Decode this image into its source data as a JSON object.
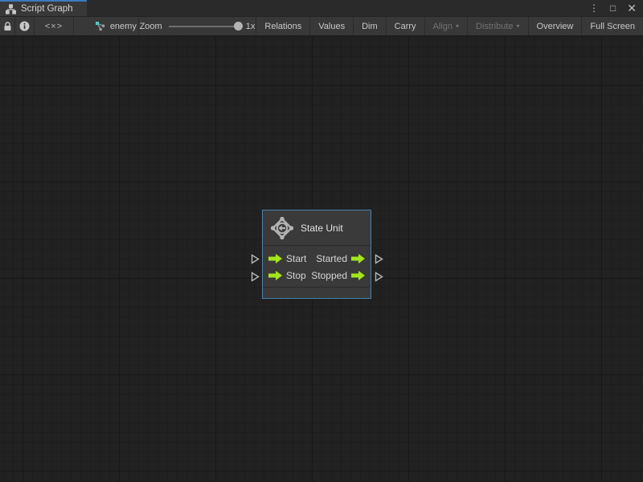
{
  "window": {
    "tab_title": "Script Graph",
    "controls": {
      "menu": "⋮",
      "maximize": "□",
      "close": "✕"
    }
  },
  "toolbar": {
    "lock_icon": "lock-icon",
    "info_icon": "info-icon",
    "code_toggle_label": "<×>",
    "breadcrumb": {
      "graph_name": "enemy"
    },
    "zoom": {
      "label": "Zoom",
      "value": "1x",
      "slider_position": 1.0
    },
    "buttons": [
      {
        "label": "Relations",
        "enabled": true,
        "dropdown": false
      },
      {
        "label": "Values",
        "enabled": true,
        "dropdown": false
      },
      {
        "label": "Dim",
        "enabled": true,
        "dropdown": false
      },
      {
        "label": "Carry",
        "enabled": true,
        "dropdown": false
      },
      {
        "label": "Align",
        "enabled": false,
        "dropdown": true
      },
      {
        "label": "Distribute",
        "enabled": false,
        "dropdown": true
      },
      {
        "label": "Overview",
        "enabled": true,
        "dropdown": false
      },
      {
        "label": "Full Screen",
        "enabled": true,
        "dropdown": false
      }
    ],
    "caret_glyph": "▾"
  },
  "canvas": {
    "node": {
      "title": "State Unit",
      "icon": "state-unit-icon",
      "input_ports": [
        {
          "label": "Start"
        },
        {
          "label": "Stop"
        }
      ],
      "output_ports": [
        {
          "label": "Started"
        },
        {
          "label": "Stopped"
        }
      ]
    }
  },
  "colors": {
    "accent_blue": "#3b79bd",
    "node_border_selected": "#4a80ab",
    "flow_port_green": "#a2e61b",
    "disabled_text": "#737373",
    "canvas_bg": "#212121",
    "panel_bg": "#383838"
  }
}
